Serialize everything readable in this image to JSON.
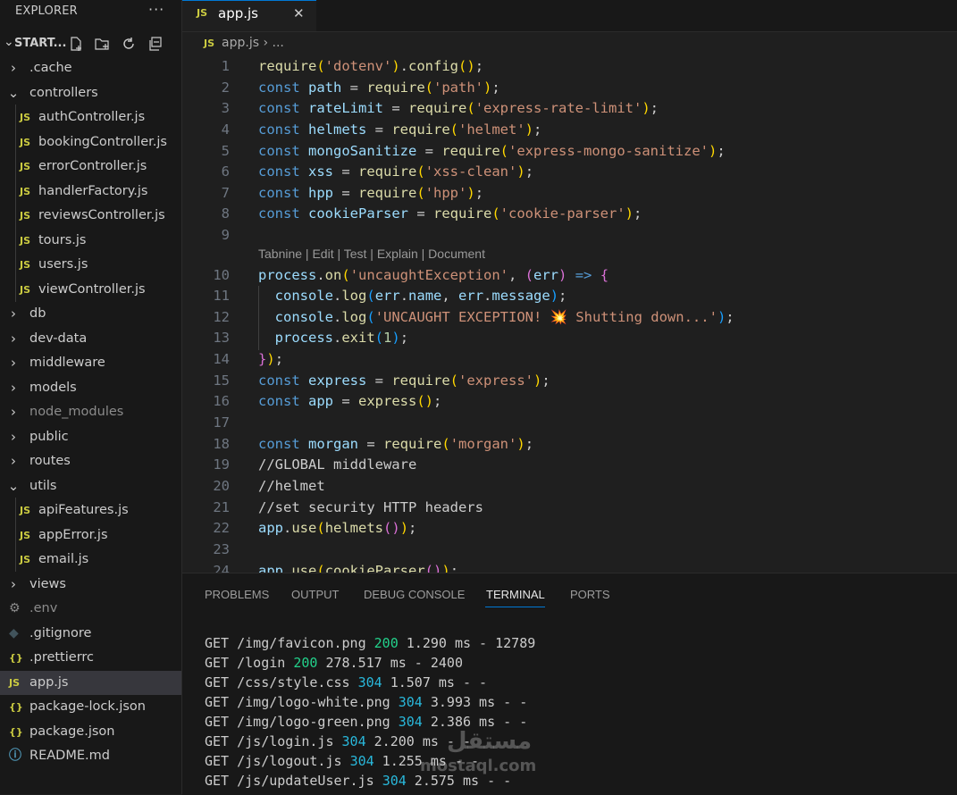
{
  "sidebar": {
    "title": "EXPLORER",
    "more": "···",
    "root": "START...",
    "items": [
      {
        "label": ".cache",
        "kind": "folder",
        "open": false,
        "depth": 0
      },
      {
        "label": "controllers",
        "kind": "folder",
        "open": true,
        "depth": 0
      },
      {
        "label": "authController.js",
        "kind": "js",
        "depth": 1
      },
      {
        "label": "bookingController.js",
        "kind": "js",
        "depth": 1
      },
      {
        "label": "errorController.js",
        "kind": "js",
        "depth": 1
      },
      {
        "label": "handlerFactory.js",
        "kind": "js",
        "depth": 1
      },
      {
        "label": "reviewsController.js",
        "kind": "js",
        "depth": 1
      },
      {
        "label": "tours.js",
        "kind": "js",
        "depth": 1
      },
      {
        "label": "users.js",
        "kind": "js",
        "depth": 1
      },
      {
        "label": "viewController.js",
        "kind": "js",
        "depth": 1
      },
      {
        "label": "db",
        "kind": "folder",
        "open": false,
        "depth": 0
      },
      {
        "label": "dev-data",
        "kind": "folder",
        "open": false,
        "depth": 0
      },
      {
        "label": "middleware",
        "kind": "folder",
        "open": false,
        "depth": 0
      },
      {
        "label": "models",
        "kind": "folder",
        "open": false,
        "depth": 0
      },
      {
        "label": "node_modules",
        "kind": "folder",
        "open": false,
        "depth": 0,
        "dim": true
      },
      {
        "label": "public",
        "kind": "folder",
        "open": false,
        "depth": 0
      },
      {
        "label": "routes",
        "kind": "folder",
        "open": false,
        "depth": 0
      },
      {
        "label": "utils",
        "kind": "folder",
        "open": true,
        "depth": 0
      },
      {
        "label": "apiFeatures.js",
        "kind": "js",
        "depth": 1
      },
      {
        "label": "appError.js",
        "kind": "js",
        "depth": 1
      },
      {
        "label": "email.js",
        "kind": "js",
        "depth": 1
      },
      {
        "label": "views",
        "kind": "folder",
        "open": false,
        "depth": 0
      },
      {
        "label": ".env",
        "kind": "env",
        "depth": 0,
        "dim": true
      },
      {
        "label": ".gitignore",
        "kind": "git",
        "depth": 0
      },
      {
        "label": ".prettierrc",
        "kind": "json",
        "depth": 0
      },
      {
        "label": "app.js",
        "kind": "js",
        "depth": 0,
        "active": true
      },
      {
        "label": "package-lock.json",
        "kind": "json",
        "depth": 0
      },
      {
        "label": "package.json",
        "kind": "json",
        "depth": 0
      },
      {
        "label": "README.md",
        "kind": "info",
        "depth": 0
      }
    ]
  },
  "editor": {
    "tab": {
      "icon": "JS",
      "label": "app.js",
      "close": "✕"
    },
    "breadcrumb": {
      "icon": "JS",
      "file": "app.js",
      "rest": "› ..."
    },
    "codelens": "Tabnine | Edit | Test | Explain | Document",
    "line_numbers": [
      "1",
      "2",
      "3",
      "4",
      "5",
      "6",
      "7",
      "8",
      "9",
      "10",
      "11",
      "12",
      "13",
      "14",
      "15",
      "16",
      "17",
      "18",
      "19",
      "20",
      "21",
      "22",
      "23",
      "24"
    ]
  },
  "panel": {
    "tabs": [
      "PROBLEMS",
      "OUTPUT",
      "DEBUG CONSOLE",
      "TERMINAL",
      "PORTS"
    ],
    "active_tab": "TERMINAL",
    "terminal": [
      {
        "pre": "GET /img/favicon.png ",
        "code": "200",
        "post": " 1.290 ms - 12789"
      },
      {
        "pre": "GET /login ",
        "code": "200",
        "post": " 278.517 ms - 2400"
      },
      {
        "pre": "GET /css/style.css ",
        "code": "304",
        "post": " 1.507 ms - -"
      },
      {
        "pre": "GET /img/logo-white.png ",
        "code": "304",
        "post": " 3.993 ms - -"
      },
      {
        "pre": "GET /img/logo-green.png ",
        "code": "304",
        "post": " 2.386 ms - -"
      },
      {
        "pre": "GET /js/login.js ",
        "code": "304",
        "post": " 2.200 ms - -"
      },
      {
        "pre": "GET /js/logout.js ",
        "code": "304",
        "post": " 1.255 ms - -"
      },
      {
        "pre": "GET /js/updateUser.js ",
        "code": "304",
        "post": " 2.575 ms - -"
      }
    ]
  },
  "watermark": {
    "arabic": "مستقل",
    "latin": "mostaql.com"
  },
  "colors": {
    "accent": "#0078d4",
    "js_icon": "#cbcb41",
    "status_200": "#23d18b",
    "status_304": "#29b8db"
  }
}
